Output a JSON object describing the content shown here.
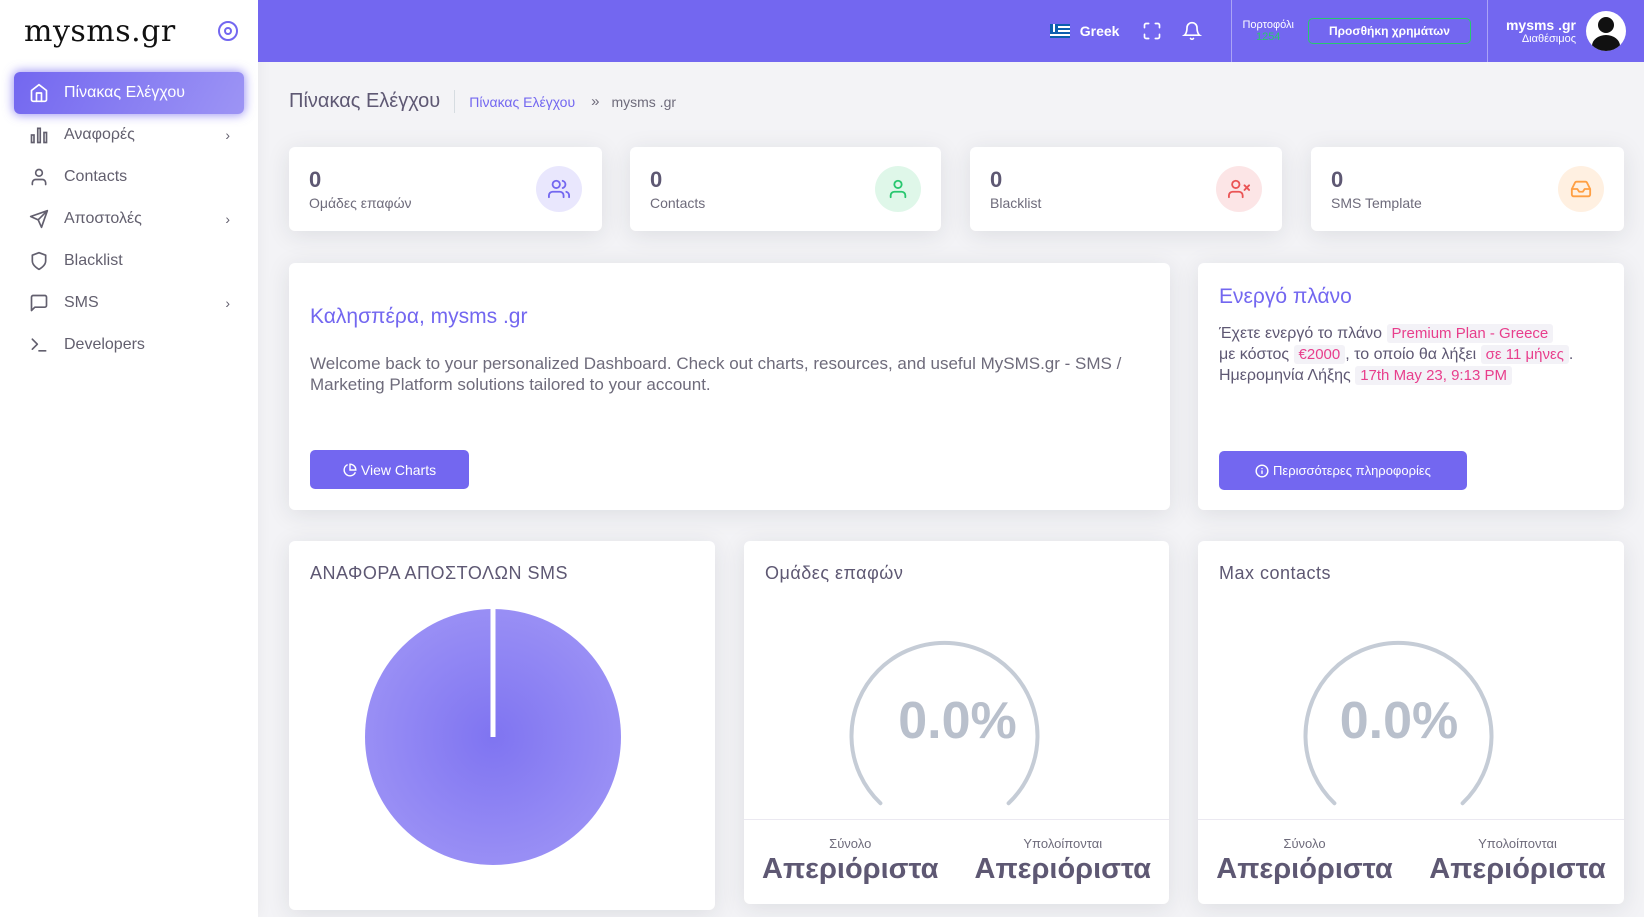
{
  "brand": {
    "logo": "mysms.gr"
  },
  "sidebar": {
    "items": [
      {
        "label": "Πίνακας Ελέγχου",
        "icon": "home-icon",
        "active": true,
        "chevron": false
      },
      {
        "label": "Αναφορές",
        "icon": "bar-chart-icon",
        "chevron": true
      },
      {
        "label": "Contacts",
        "icon": "user-icon",
        "chevron": false
      },
      {
        "label": "Αποστολές",
        "icon": "send-icon",
        "chevron": true
      },
      {
        "label": "Blacklist",
        "icon": "shield-icon",
        "chevron": false
      },
      {
        "label": "SMS",
        "icon": "message-square-icon",
        "chevron": true
      },
      {
        "label": "Developers",
        "icon": "terminal-icon",
        "chevron": false
      }
    ],
    "chevron_glyph": "›"
  },
  "header": {
    "language": "Greek",
    "wallet_label": "Πορτοφόλι",
    "wallet_amount": "1254",
    "add_funds": "Προσθήκη χρημάτων",
    "user_name": "mysms .gr",
    "user_status": "Διαθέσιμος"
  },
  "breadcrumb": {
    "title": "Πίνακας Ελέγχου",
    "link": "Πίνακας Ελέγχου",
    "separator": "»",
    "current": "mysms .gr"
  },
  "stats": [
    {
      "value": "0",
      "label": "Ομάδες επαφών",
      "icon": "users-icon",
      "color": "#7367f0",
      "bg": "#e9e7fd"
    },
    {
      "value": "0",
      "label": "Contacts",
      "icon": "user-icon",
      "color": "#28c76f",
      "bg": "#dff7e9"
    },
    {
      "value": "0",
      "label": "Blacklist",
      "icon": "user-x-icon",
      "color": "#ea5455",
      "bg": "#fce5e6"
    },
    {
      "value": "0",
      "label": "SMS Template",
      "icon": "inbox-icon",
      "color": "#ff9f43",
      "bg": "#fff0e1"
    }
  ],
  "welcome": {
    "title": "Καλησπέρα, mysms .gr",
    "text": "Welcome back to your personalized Dashboard. Check out charts, resources, and useful MySMS.gr - SMS / Marketing Platform solutions tailored to your account.",
    "button": "View Charts"
  },
  "plan": {
    "title": "Ενεργό πλάνο",
    "t1": "Έχετε ενεργό το πλάνο",
    "plan_name": "Premium Plan - Greece",
    "t2": "με κόστος",
    "cost": "€2000",
    "t3": ", το οποίο θα λήξει",
    "expires_in": "σε 11 μήνες",
    "t4": ".",
    "t5": "Ημερομηνία Λήξης",
    "expiry_date": "17th May 23, 9:13 PM",
    "button": "Περισσότερες πληροφορίες"
  },
  "sms_report": {
    "title": "ΑΝΑΦΟΡΑ ΑΠΟΣΤΟΛΩΝ SMS"
  },
  "chart_data": {
    "type": "pie",
    "title": "ΑΝΑΦΟΡΑ ΑΠΟΣΤΟΛΩΝ SMS",
    "categories": [
      ""
    ],
    "values": [
      100
    ],
    "colors": [
      "#8f85f3"
    ]
  },
  "groups_gauge": {
    "title": "Ομάδες επαφών",
    "value": "0.0%",
    "total_label": "Σύνολο",
    "total_value": "Απεριόριστα",
    "remaining_label": "Υπολοίπονται",
    "remaining_value": "Απεριόριστα"
  },
  "max_gauge": {
    "title": "Max contacts",
    "value": "0.0%",
    "total_label": "Σύνολο",
    "total_value": "Απεριόριστα",
    "remaining_label": "Υπολοίπονται",
    "remaining_value": "Απεριόριστα"
  }
}
